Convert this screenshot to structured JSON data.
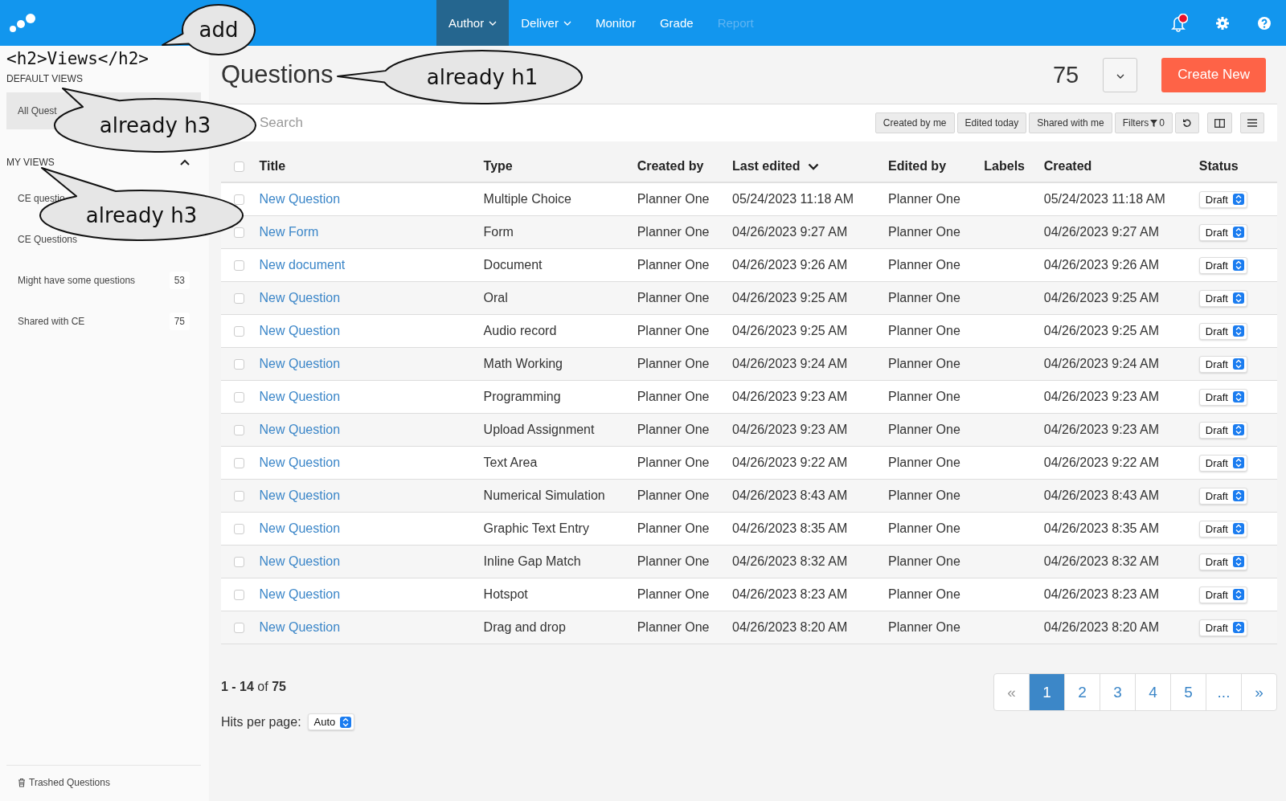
{
  "nav": [
    {
      "label": "Author",
      "selected": true,
      "disabled": false,
      "dropdown": true
    },
    {
      "label": "Deliver",
      "selected": false,
      "disabled": false,
      "dropdown": true
    },
    {
      "label": "Monitor",
      "selected": false,
      "disabled": false,
      "dropdown": false
    },
    {
      "label": "Grade",
      "selected": false,
      "disabled": false,
      "dropdown": false
    },
    {
      "label": "Report",
      "selected": false,
      "disabled": true,
      "dropdown": false
    }
  ],
  "notifications": {
    "unread": true
  },
  "sidebar": {
    "note": "<h2>Views</h2>",
    "sections": [
      {
        "title": "DEFAULT VIEWS",
        "collapsible": false,
        "items": [
          {
            "label": "All Quest",
            "selected": true
          }
        ]
      },
      {
        "title": "MY VIEWS",
        "collapsible": true,
        "items": [
          {
            "label": "CE questio",
            "selected": false
          },
          {
            "label": "CE Questions",
            "selected": false
          },
          {
            "label": "Might have some questions",
            "count": "53",
            "selected": false
          },
          {
            "label": "Shared with CE",
            "count": "75",
            "selected": false
          }
        ]
      }
    ],
    "trash": "Trashed Questions"
  },
  "page": {
    "title": "Questions",
    "count": "75",
    "create": "Create New"
  },
  "toolbar": {
    "search_placeholder": "Search",
    "quick_filters": [
      "Created by me",
      "Edited today",
      "Shared with me"
    ],
    "filters_label": "Filters",
    "filters_count": "0"
  },
  "table": {
    "all_checked": false,
    "columns": [
      {
        "label": "Title",
        "sorted": false
      },
      {
        "label": "Type",
        "sorted": false
      },
      {
        "label": "Created by",
        "sorted": false
      },
      {
        "label": "Last edited",
        "sorted": true
      },
      {
        "label": "Edited by",
        "sorted": false
      },
      {
        "label": "Labels",
        "sorted": false
      },
      {
        "label": "Created",
        "sorted": false
      },
      {
        "label": "Status",
        "sorted": false
      }
    ],
    "rows": [
      {
        "checked": false,
        "title": "New Question",
        "type": "Multiple Choice",
        "created_by": "Planner One",
        "last_edited": "05/24/2023 11:18 AM",
        "edited_by": "Planner One",
        "created": "05/24/2023 11:18 AM",
        "status": "Draft"
      },
      {
        "checked": false,
        "title": "New Form",
        "type": "Form",
        "created_by": "Planner One",
        "last_edited": "04/26/2023 9:27 AM",
        "edited_by": "Planner One",
        "created": "04/26/2023 9:27 AM",
        "status": "Draft"
      },
      {
        "checked": false,
        "title": "New document",
        "type": "Document",
        "created_by": "Planner One",
        "last_edited": "04/26/2023 9:26 AM",
        "edited_by": "Planner One",
        "created": "04/26/2023 9:26 AM",
        "status": "Draft"
      },
      {
        "checked": false,
        "title": "New Question",
        "type": "Oral",
        "created_by": "Planner One",
        "last_edited": "04/26/2023 9:25 AM",
        "edited_by": "Planner One",
        "created": "04/26/2023 9:25 AM",
        "status": "Draft"
      },
      {
        "checked": false,
        "title": "New Question",
        "type": "Audio record",
        "created_by": "Planner One",
        "last_edited": "04/26/2023 9:25 AM",
        "edited_by": "Planner One",
        "created": "04/26/2023 9:25 AM",
        "status": "Draft"
      },
      {
        "checked": false,
        "title": "New Question",
        "type": "Math Working",
        "created_by": "Planner One",
        "last_edited": "04/26/2023 9:24 AM",
        "edited_by": "Planner One",
        "created": "04/26/2023 9:24 AM",
        "status": "Draft"
      },
      {
        "checked": false,
        "title": "New Question",
        "type": "Programming",
        "created_by": "Planner One",
        "last_edited": "04/26/2023 9:23 AM",
        "edited_by": "Planner One",
        "created": "04/26/2023 9:23 AM",
        "status": "Draft"
      },
      {
        "checked": false,
        "title": "New Question",
        "type": "Upload Assignment",
        "created_by": "Planner One",
        "last_edited": "04/26/2023 9:23 AM",
        "edited_by": "Planner One",
        "created": "04/26/2023 9:23 AM",
        "status": "Draft"
      },
      {
        "checked": false,
        "title": "New Question",
        "type": "Text Area",
        "created_by": "Planner One",
        "last_edited": "04/26/2023 9:22 AM",
        "edited_by": "Planner One",
        "created": "04/26/2023 9:22 AM",
        "status": "Draft"
      },
      {
        "checked": false,
        "title": "New Question",
        "type": "Numerical Simulation",
        "created_by": "Planner One",
        "last_edited": "04/26/2023 8:43 AM",
        "edited_by": "Planner One",
        "created": "04/26/2023 8:43 AM",
        "status": "Draft"
      },
      {
        "checked": false,
        "title": "New Question",
        "type": "Graphic Text Entry",
        "created_by": "Planner One",
        "last_edited": "04/26/2023 8:35 AM",
        "edited_by": "Planner One",
        "created": "04/26/2023 8:35 AM",
        "status": "Draft"
      },
      {
        "checked": false,
        "title": "New Question",
        "type": "Inline Gap Match",
        "created_by": "Planner One",
        "last_edited": "04/26/2023 8:32 AM",
        "edited_by": "Planner One",
        "created": "04/26/2023 8:32 AM",
        "status": "Draft"
      },
      {
        "checked": false,
        "title": "New Question",
        "type": "Hotspot",
        "created_by": "Planner One",
        "last_edited": "04/26/2023 8:23 AM",
        "edited_by": "Planner One",
        "created": "04/26/2023 8:23 AM",
        "status": "Draft"
      },
      {
        "checked": false,
        "title": "New Question",
        "type": "Drag and drop",
        "created_by": "Planner One",
        "last_edited": "04/26/2023 8:20 AM",
        "edited_by": "Planner One",
        "created": "04/26/2023 8:20 AM",
        "status": "Draft"
      }
    ]
  },
  "footer": {
    "range": "**1 - 14** of **75**",
    "hits_label": "Hits per page:",
    "hits_value": "Auto",
    "prev": "«",
    "next": "»",
    "pages": [
      {
        "label": "1",
        "selected": true
      },
      {
        "label": "2",
        "selected": false
      },
      {
        "label": "3",
        "selected": false
      },
      {
        "label": "4",
        "selected": false
      },
      {
        "label": "5",
        "selected": false
      },
      {
        "label": "...",
        "selected": false
      }
    ]
  },
  "annotations": [
    {
      "text": "add"
    },
    {
      "text": "already h1"
    },
    {
      "text": "already h3"
    },
    {
      "text": "already h3"
    }
  ]
}
